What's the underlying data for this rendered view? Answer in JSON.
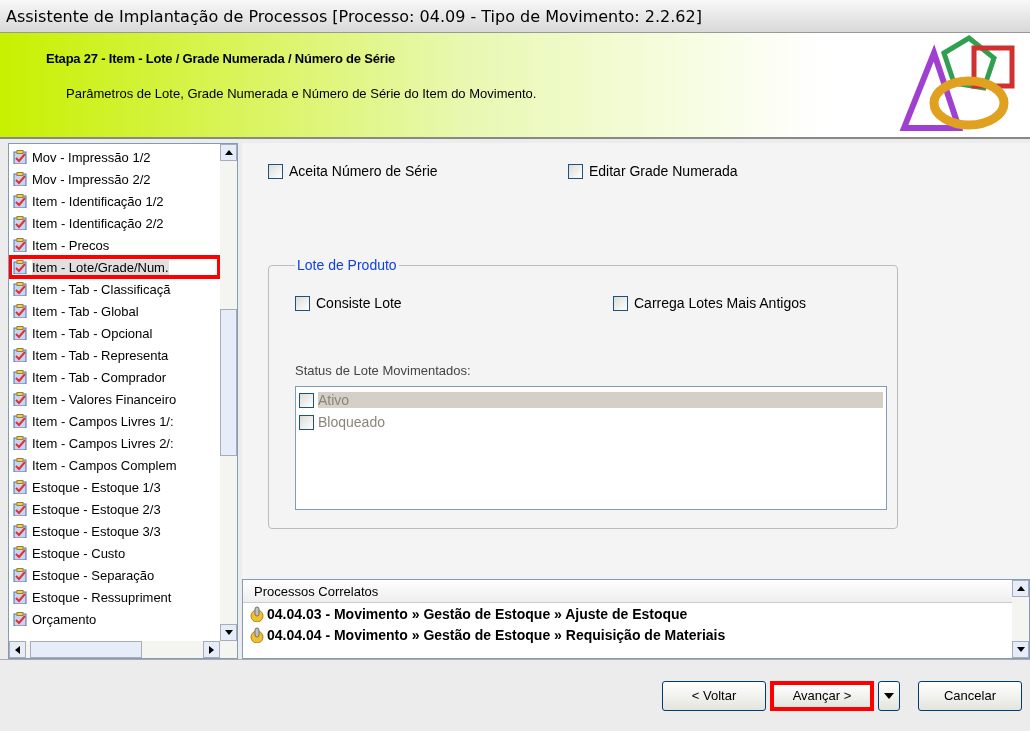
{
  "window": {
    "title": "Assistente de Implantação de Processos [Processo: 04.09 - Tipo de Movimento: 2.2.62]"
  },
  "header": {
    "title": "Etapa 27 - Item - Lote / Grade Numerada / Número de Série",
    "subtitle": "Parâmetros de Lote, Grade Numerada e Número de Série do Item do Movimento."
  },
  "sidebar": {
    "items": [
      {
        "label": "Mov - Impressão 1/2",
        "selected": false,
        "highlighted": false
      },
      {
        "label": "Mov - Impressão 2/2",
        "selected": false,
        "highlighted": false
      },
      {
        "label": "Item - Identificação 1/2",
        "selected": false,
        "highlighted": false
      },
      {
        "label": "Item - Identificação 2/2",
        "selected": false,
        "highlighted": false
      },
      {
        "label": "Item - Precos",
        "selected": false,
        "highlighted": false
      },
      {
        "label": "Item - Lote/Grade/Num.",
        "selected": true,
        "highlighted": true
      },
      {
        "label": "Item - Tab - Classificaçã",
        "selected": false,
        "highlighted": false
      },
      {
        "label": "Item - Tab - Global",
        "selected": false,
        "highlighted": false
      },
      {
        "label": "Item - Tab - Opcional",
        "selected": false,
        "highlighted": false
      },
      {
        "label": "Item - Tab - Representa",
        "selected": false,
        "highlighted": false
      },
      {
        "label": "Item - Tab - Comprador",
        "selected": false,
        "highlighted": false
      },
      {
        "label": "Item - Valores Financeiro",
        "selected": false,
        "highlighted": false
      },
      {
        "label": "Item - Campos Livres 1/:",
        "selected": false,
        "highlighted": false
      },
      {
        "label": "Item - Campos Livres 2/:",
        "selected": false,
        "highlighted": false
      },
      {
        "label": "Item - Campos Complem",
        "selected": false,
        "highlighted": false
      },
      {
        "label": "Estoque - Estoque 1/3",
        "selected": false,
        "highlighted": false
      },
      {
        "label": "Estoque - Estoque 2/3",
        "selected": false,
        "highlighted": false
      },
      {
        "label": "Estoque - Estoque 3/3",
        "selected": false,
        "highlighted": false
      },
      {
        "label": "Estoque - Custo",
        "selected": false,
        "highlighted": false
      },
      {
        "label": "Estoque - Separação",
        "selected": false,
        "highlighted": false
      },
      {
        "label": "Estoque - Ressupriment",
        "selected": false,
        "highlighted": false
      },
      {
        "label": "Orçamento",
        "selected": false,
        "highlighted": false
      }
    ]
  },
  "options": [
    {
      "label": "Aceita Número de Série",
      "checked": false
    },
    {
      "label": "Editar Grade Numerada",
      "checked": false
    }
  ],
  "lote_group": {
    "title": "Lote de Produto",
    "options": [
      {
        "label": "Consiste Lote",
        "checked": false
      },
      {
        "label": "Carrega Lotes Mais Antigos",
        "checked": false
      }
    ],
    "status_label": "Status de Lote Movimentados:",
    "status_items": [
      {
        "label": "Ativo",
        "checked": false,
        "selected": true,
        "disabled": true
      },
      {
        "label": "Bloqueado",
        "checked": false,
        "selected": false,
        "disabled": true
      }
    ]
  },
  "related": {
    "title": "Processos Correlatos",
    "items": [
      "04.04.03 - Movimento » Gestão de Estoque » Ajuste de Estoque",
      "04.04.04 - Movimento » Gestão de Estoque » Requisição de Materiais"
    ]
  },
  "buttons": [
    {
      "kind": "back",
      "label": "< Voltar",
      "highlighted": false
    },
    {
      "kind": "next",
      "label": "Avançar >",
      "highlighted": true
    },
    {
      "kind": "dropdown",
      "highlighted": false
    },
    {
      "kind": "cancel",
      "label": "Cancelar",
      "highlighted": false
    }
  ]
}
